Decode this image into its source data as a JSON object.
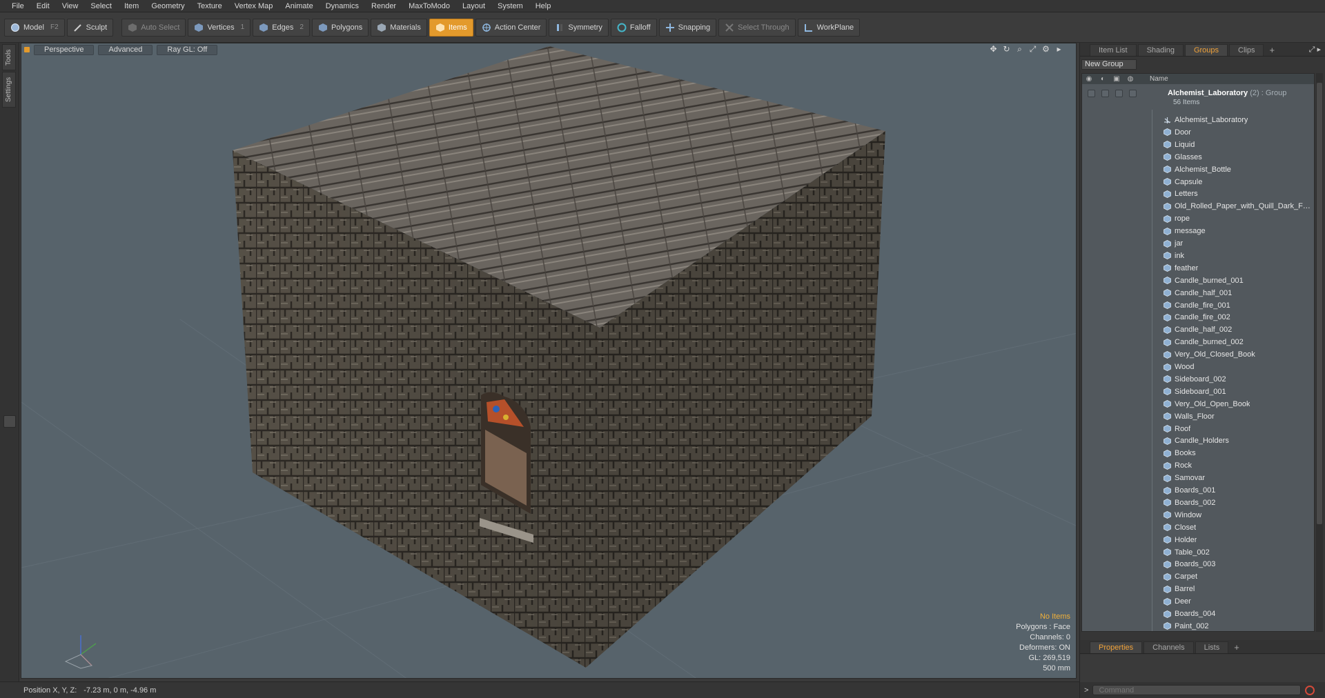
{
  "menu": [
    "File",
    "Edit",
    "View",
    "Select",
    "Item",
    "Geometry",
    "Texture",
    "Vertex Map",
    "Animate",
    "Dynamics",
    "Render",
    "MaxToModo",
    "Layout",
    "System",
    "Help"
  ],
  "toolbar": {
    "model": "Model",
    "model_key": "F2",
    "sculpt": "Sculpt",
    "auto_select": "Auto Select",
    "vertices": "Vertices",
    "vertices_key": "1",
    "edges": "Edges",
    "edges_key": "2",
    "polygons": "Polygons",
    "materials": "Materials",
    "items": "Items",
    "action_center": "Action Center",
    "symmetry": "Symmetry",
    "falloff": "Falloff",
    "snapping": "Snapping",
    "select_through": "Select Through",
    "workplane": "WorkPlane"
  },
  "left_tabs": [
    "Tools",
    "Settings"
  ],
  "viewport": {
    "view": "Perspective",
    "mode": "Advanced",
    "raygl": "Ray GL: Off",
    "info": {
      "selection": "No Items",
      "polygons": "Polygons : Face",
      "channels": "Channels: 0",
      "deformers": "Deformers: ON",
      "gl": "GL: 269,519",
      "scale": "500 mm"
    }
  },
  "status": {
    "label": "Position X, Y, Z:",
    "value": "-7.23 m, 0 m, -4.96 m"
  },
  "panel": {
    "tabs": [
      "Item List",
      "Shading",
      "Groups",
      "Clips"
    ],
    "active_tab": "Groups",
    "new_group": "New Group",
    "column_name": "Name",
    "group_name": "Alchemist_Laboratory",
    "group_suffix": "(2) : Group",
    "group_count": "56 Items",
    "items": [
      "Alchemist_Laboratory",
      "Door",
      "Liquid",
      "Glasses",
      "Alchemist_Bottle",
      "Capsule",
      "Letters",
      "Old_Rolled_Paper_with_Quill_Dark_Fe...",
      "rope",
      "message",
      "jar",
      "ink",
      "feather",
      "Candle_burned_001",
      "Candle_half_001",
      "Candle_fire_001",
      "Candle_fire_002",
      "Candle_half_002",
      "Candle_burned_002",
      "Very_Old_Closed_Book",
      "Wood",
      "Sideboard_002",
      "Sideboard_001",
      "Very_Old_Open_Book",
      "Walls_Floor",
      "Roof",
      "Candle_Holders",
      "Books",
      "Rock",
      "Samovar",
      "Boards_001",
      "Boards_002",
      "Window",
      "Closet",
      "Holder",
      "Table_002",
      "Boards_003",
      "Carpet",
      "Barrel",
      "Deer",
      "Boards_004",
      "Paint_002"
    ],
    "bottom_tabs": [
      "Properties",
      "Channels",
      "Lists"
    ],
    "active_bottom_tab": "Properties",
    "command_placeholder": "Command"
  },
  "colors": {
    "accent": "#e39a2c",
    "viewport_bg": "#57636b"
  }
}
